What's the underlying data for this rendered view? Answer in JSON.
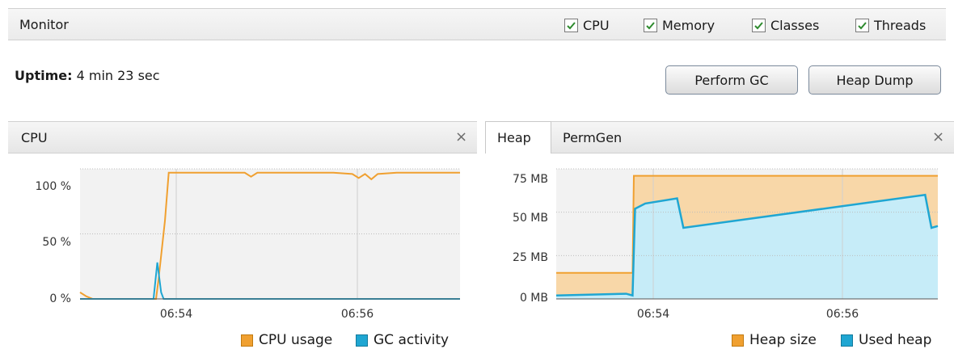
{
  "monitor": {
    "title": "Monitor",
    "checkboxes": [
      {
        "label": "CPU",
        "checked": true
      },
      {
        "label": "Memory",
        "checked": true
      },
      {
        "label": "Classes",
        "checked": true
      },
      {
        "label": "Threads",
        "checked": true
      }
    ]
  },
  "uptime": {
    "label": "Uptime:",
    "value": "4 min 23 sec"
  },
  "buttons": {
    "perform_gc": "Perform GC",
    "heap_dump": "Heap Dump"
  },
  "cpu_panel": {
    "title": "CPU",
    "close_glyph": "×"
  },
  "heap_panel": {
    "tabs": [
      "Heap",
      "PermGen"
    ],
    "active_tab": "Heap",
    "close_glyph": "×"
  },
  "colors": {
    "orange": "#f0a030",
    "blue": "#1fa6d2",
    "heap_fill": "#f8d7a8",
    "used_fill": "#c6ecf8",
    "plot_bg": "#f2f2f2"
  },
  "chart_data": [
    {
      "type": "line",
      "name_panel": "CPU",
      "x_ticks": [
        "06:54",
        "06:56"
      ],
      "y_ticks": [
        "0 %",
        "50 %",
        "100 %"
      ],
      "ylim": [
        0,
        100
      ],
      "xlim_minutes": [
        6.0,
        9.0
      ],
      "series": [
        {
          "name": "CPU usage",
          "color": "#f0a030",
          "points": [
            [
              6.0,
              5
            ],
            [
              6.05,
              2
            ],
            [
              6.1,
              0
            ],
            [
              6.6,
              0
            ],
            [
              6.62,
              15
            ],
            [
              6.67,
              60
            ],
            [
              6.7,
              97
            ],
            [
              7.0,
              97
            ],
            [
              7.3,
              97
            ],
            [
              7.35,
              94
            ],
            [
              7.4,
              97
            ],
            [
              8.0,
              97
            ],
            [
              8.15,
              96
            ],
            [
              8.2,
              93
            ],
            [
              8.25,
              96
            ],
            [
              8.3,
              92
            ],
            [
              8.35,
              96
            ],
            [
              8.5,
              97
            ],
            [
              9.0,
              97
            ]
          ]
        },
        {
          "name": "GC activity",
          "color": "#1fa6d2",
          "points": [
            [
              6.0,
              0
            ],
            [
              6.58,
              0
            ],
            [
              6.61,
              28
            ],
            [
              6.64,
              5
            ],
            [
              6.66,
              0
            ],
            [
              9.0,
              0
            ]
          ]
        }
      ],
      "legend": [
        "CPU usage",
        "GC activity"
      ]
    },
    {
      "type": "area",
      "name_panel": "Heap",
      "x_ticks": [
        "06:54",
        "06:56"
      ],
      "y_ticks": [
        "0 MB",
        "25 MB",
        "50 MB",
        "75 MB"
      ],
      "ylim": [
        0,
        75
      ],
      "xlim_minutes": [
        6.0,
        9.0
      ],
      "series": [
        {
          "name": "Heap size",
          "color": "#f0a030",
          "points": [
            [
              6.0,
              15
            ],
            [
              6.6,
              15
            ],
            [
              6.61,
              71
            ],
            [
              9.0,
              71
            ]
          ]
        },
        {
          "name": "Used heap",
          "color": "#1fa6d2",
          "points": [
            [
              6.0,
              2
            ],
            [
              6.55,
              3
            ],
            [
              6.6,
              2
            ],
            [
              6.62,
              52
            ],
            [
              6.7,
              55
            ],
            [
              6.95,
              58
            ],
            [
              7.0,
              41
            ],
            [
              8.9,
              60
            ],
            [
              8.95,
              41
            ],
            [
              9.0,
              42
            ]
          ]
        }
      ],
      "legend": [
        "Heap size",
        "Used heap"
      ]
    }
  ]
}
